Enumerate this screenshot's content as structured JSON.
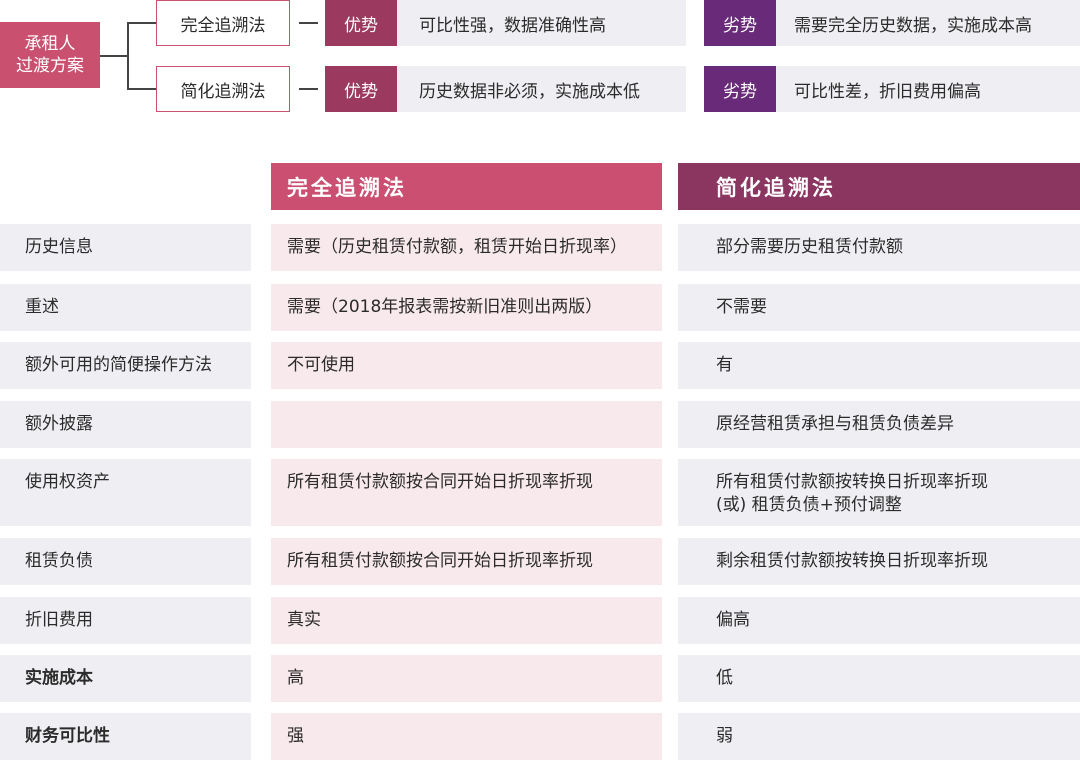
{
  "diagram": {
    "root_label_line1": "承租人",
    "root_label_line2": "过渡方案",
    "branches": [
      {
        "method": "完全追溯法",
        "advantage_tag": "优势",
        "advantage_text": "可比性强，数据准确性高",
        "disadvantage_tag": "劣势",
        "disadvantage_text": "需要完全历史数据，实施成本高"
      },
      {
        "method": "简化追溯法",
        "advantage_tag": "优势",
        "advantage_text": "历史数据非必须，实施成本低",
        "disadvantage_tag": "劣势",
        "disadvantage_text": "可比性差，折旧费用偏高"
      }
    ]
  },
  "table": {
    "headers": {
      "full": "完全追溯法",
      "simple": "简化追溯法"
    },
    "rows": [
      {
        "label": "历史信息",
        "full": [
          "需要（历史租赁付款额，租赁开始日折现率）"
        ],
        "simple": [
          "部分需要历史租赁付款额"
        ]
      },
      {
        "label": "重述",
        "full": [
          "需要（2018年报表需按新旧准则出两版）"
        ],
        "simple": [
          "不需要"
        ]
      },
      {
        "label": "额外可用的简便操作方法",
        "full": [
          "不可使用"
        ],
        "simple": [
          "有"
        ]
      },
      {
        "label": "额外披露",
        "full": [
          ""
        ],
        "simple": [
          "原经营租赁承担与租赁负债差异"
        ]
      },
      {
        "label": "使用权资产",
        "full": [
          "所有租赁付款额按合同开始日折现率折现"
        ],
        "simple": [
          "所有租赁付款额按转换日折现率折现",
          "(或) 租赁负债+预付调整"
        ]
      },
      {
        "label": "租赁负债",
        "full": [
          "所有租赁付款额按合同开始日折现率折现"
        ],
        "simple": [
          "剩余租赁付款额按转换日折现率折现"
        ]
      },
      {
        "label": "折旧费用",
        "full": [
          "真实"
        ],
        "simple": [
          "偏高"
        ]
      },
      {
        "label": "实施成本",
        "full": [
          "高"
        ],
        "simple": [
          "低"
        ]
      },
      {
        "label": "财务可比性",
        "full": [
          "强"
        ],
        "simple": [
          "弱"
        ]
      }
    ]
  },
  "colors": {
    "accent_pink": "#c9506f",
    "advantage_tag": "#9b3a5e",
    "disadvantage_tag": "#6a2a7a",
    "header_full": "#cb4f70",
    "header_simple": "#8b3561",
    "cell_gray": "#efeff3",
    "cell_pink": "#f8e9ec"
  }
}
